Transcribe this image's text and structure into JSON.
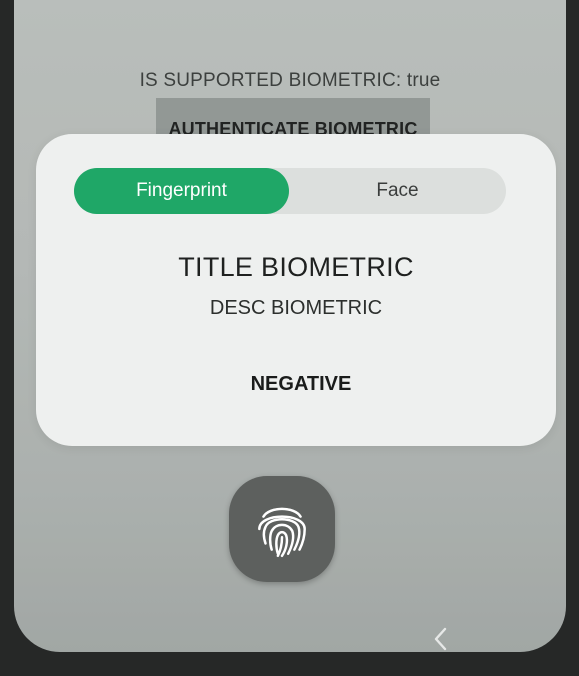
{
  "app": {
    "supported_text": "IS SUPPORTED BIOMETRIC: true",
    "authenticate_button_label": "AUTHENTICATE BIOMETRIC"
  },
  "biometric_prompt": {
    "tabs": [
      {
        "label": "Fingerprint",
        "selected": true
      },
      {
        "label": "Face",
        "selected": false
      }
    ],
    "title": "TITLE BIOMETRIC",
    "description": "DESC BIOMETRIC",
    "negative_button_label": "NEGATIVE"
  },
  "sensor": {
    "icon": "fingerprint-icon"
  },
  "navigation": {
    "icon": "back-chevron-icon"
  },
  "colors": {
    "accent": "#1fa767",
    "sheet": "#eef0ef",
    "background": "#c3c8c5",
    "sensor": "#5d605e"
  }
}
